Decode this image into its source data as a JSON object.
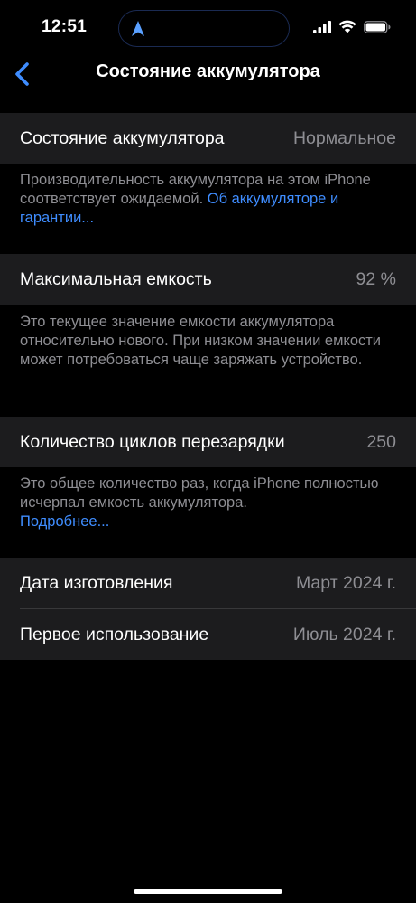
{
  "status_bar": {
    "time": "12:51",
    "icons": [
      "location-arrow-icon",
      "signal-icon",
      "wifi-icon",
      "battery-icon"
    ]
  },
  "nav": {
    "title": "Состояние аккумулятора"
  },
  "battery_health": {
    "label": "Состояние аккумулятора",
    "value": "Нормальное",
    "footer_text": "Производительность аккумулятора на этом iPhone соответствует ожидаемой. ",
    "footer_link": "Об аккуму­ляторе и гарантии..."
  },
  "max_capacity": {
    "label": "Максимальная емкость",
    "value": "92 %",
    "footer_text": "Это текущее значение емкости аккумулятора относительно нового. При низком значении емкости может потребоваться чаще заряжать устройство."
  },
  "cycle_count": {
    "label": "Количество циклов перезарядки",
    "value": "250",
    "footer_text": "Это общее количество раз, когда iPhone полностью исчерпал емкость аккумулятора.",
    "footer_link": "Подробнее..."
  },
  "dates": {
    "manufacture_label": "Дата изготовления",
    "manufacture_value": "Март 2024 г.",
    "first_use_label": "Первое использование",
    "first_use_value": "Июль 2024 г."
  },
  "colors": {
    "background": "#000000",
    "cell": "#1c1c1e",
    "secondary_text": "#8e8e93",
    "link": "#3f8dff",
    "accent": "#5aa0ff"
  }
}
